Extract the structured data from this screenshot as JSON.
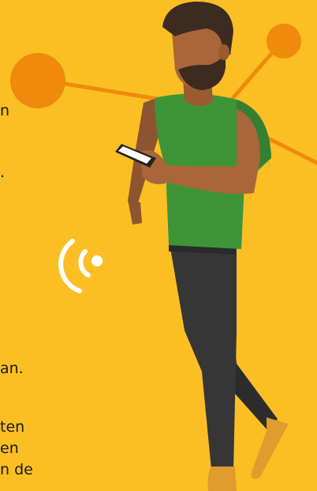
{
  "colors": {
    "background": "#fbbf24",
    "accent_orange": "#ef8a0c",
    "shirt_green": "#3f9438",
    "skin": "#a8663a",
    "pants": "#343434",
    "hair": "#3d2b20",
    "shoe": "#e29b2d",
    "signal": "#ffffff"
  },
  "icons": [
    "wireless-signal-icon",
    "smartphone-icon"
  ],
  "fragments": {
    "frag1": "n",
    "frag2": ".",
    "frag3": "an.",
    "frag4": "ten",
    "frag5": "en",
    "frag6": "n de"
  }
}
